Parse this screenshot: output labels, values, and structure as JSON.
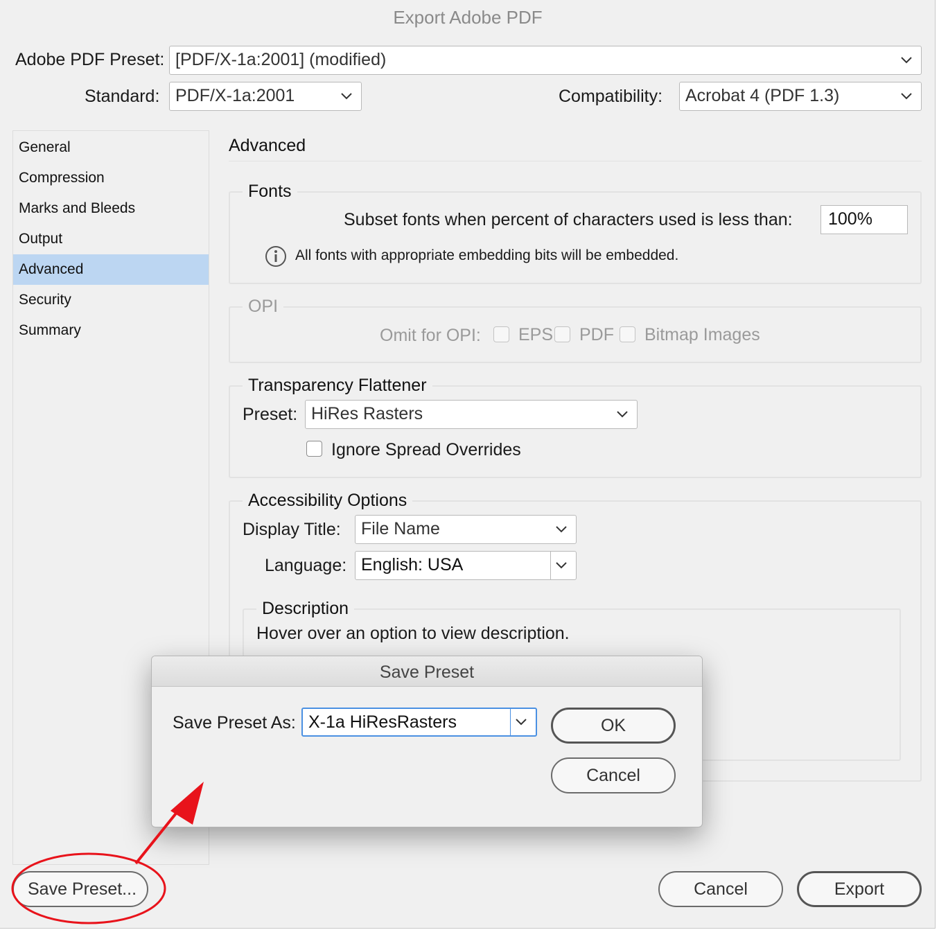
{
  "window": {
    "title": "Export Adobe PDF"
  },
  "header": {
    "preset_label": "Adobe PDF Preset:",
    "preset_value": "[PDF/X-1a:2001] (modified)",
    "standard_label": "Standard:",
    "standard_value": "PDF/X-1a:2001",
    "compat_label": "Compatibility:",
    "compat_value": "Acrobat 4 (PDF 1.3)"
  },
  "sidebar": {
    "items": [
      {
        "label": "General"
      },
      {
        "label": "Compression"
      },
      {
        "label": "Marks and Bleeds"
      },
      {
        "label": "Output"
      },
      {
        "label": "Advanced",
        "selected": true
      },
      {
        "label": "Security"
      },
      {
        "label": "Summary"
      }
    ]
  },
  "panel": {
    "title": "Advanced",
    "fonts": {
      "legend": "Fonts",
      "subset_label": "Subset fonts when percent of characters used is less than:",
      "subset_value": "100%",
      "info_text": "All fonts with appropriate embedding bits will be embedded."
    },
    "opi": {
      "legend": "OPI",
      "omit_label": "Omit for OPI:",
      "eps_label": "EPS",
      "pdf_label": "PDF",
      "bitmap_label": "Bitmap Images"
    },
    "flattener": {
      "legend": "Transparency Flattener",
      "preset_label": "Preset:",
      "preset_value": "HiRes Rasters",
      "ignore_label": "Ignore Spread Overrides"
    },
    "accessibility": {
      "legend": "Accessibility Options",
      "display_title_label": "Display Title:",
      "display_title_value": "File Name",
      "language_label": "Language:",
      "language_value": "English: USA"
    },
    "description": {
      "legend": "Description",
      "text": "Hover over an option to view description."
    }
  },
  "footer": {
    "save_preset": "Save Preset...",
    "cancel": "Cancel",
    "export": "Export"
  },
  "modal": {
    "title": "Save Preset",
    "label": "Save Preset As:",
    "value": "X-1a HiResRasters",
    "ok": "OK",
    "cancel": "Cancel"
  },
  "colors": {
    "selected_item": "#bcd6f2",
    "annotation": "#e8131b",
    "focus": "#4a90e2"
  }
}
